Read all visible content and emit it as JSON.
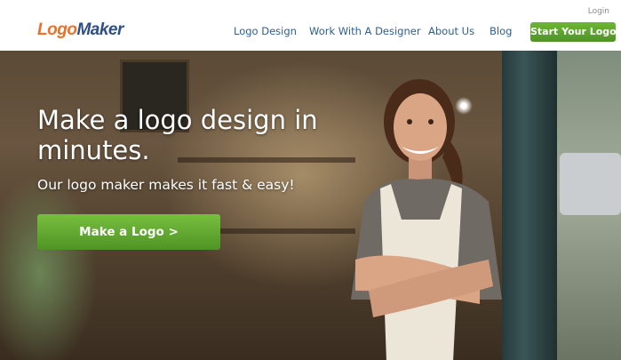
{
  "header": {
    "logo": {
      "part1": "Logo",
      "part2": "Maker"
    },
    "login_label": "Login",
    "nav": [
      {
        "label": "Logo Design"
      },
      {
        "label": "Work With A Designer"
      },
      {
        "label": "About Us"
      },
      {
        "label": "Blog"
      }
    ],
    "cta_label": "Start Your Logo"
  },
  "hero": {
    "headline": "Make a logo design in minutes.",
    "subline": "Our logo maker makes it fast & easy!",
    "cta_label": "Make a Logo >"
  },
  "colors": {
    "logo_orange": "#e8722c",
    "logo_blue": "#2d4f86",
    "nav_text": "#2d5f8e",
    "cta_green": "#5fa52e"
  }
}
